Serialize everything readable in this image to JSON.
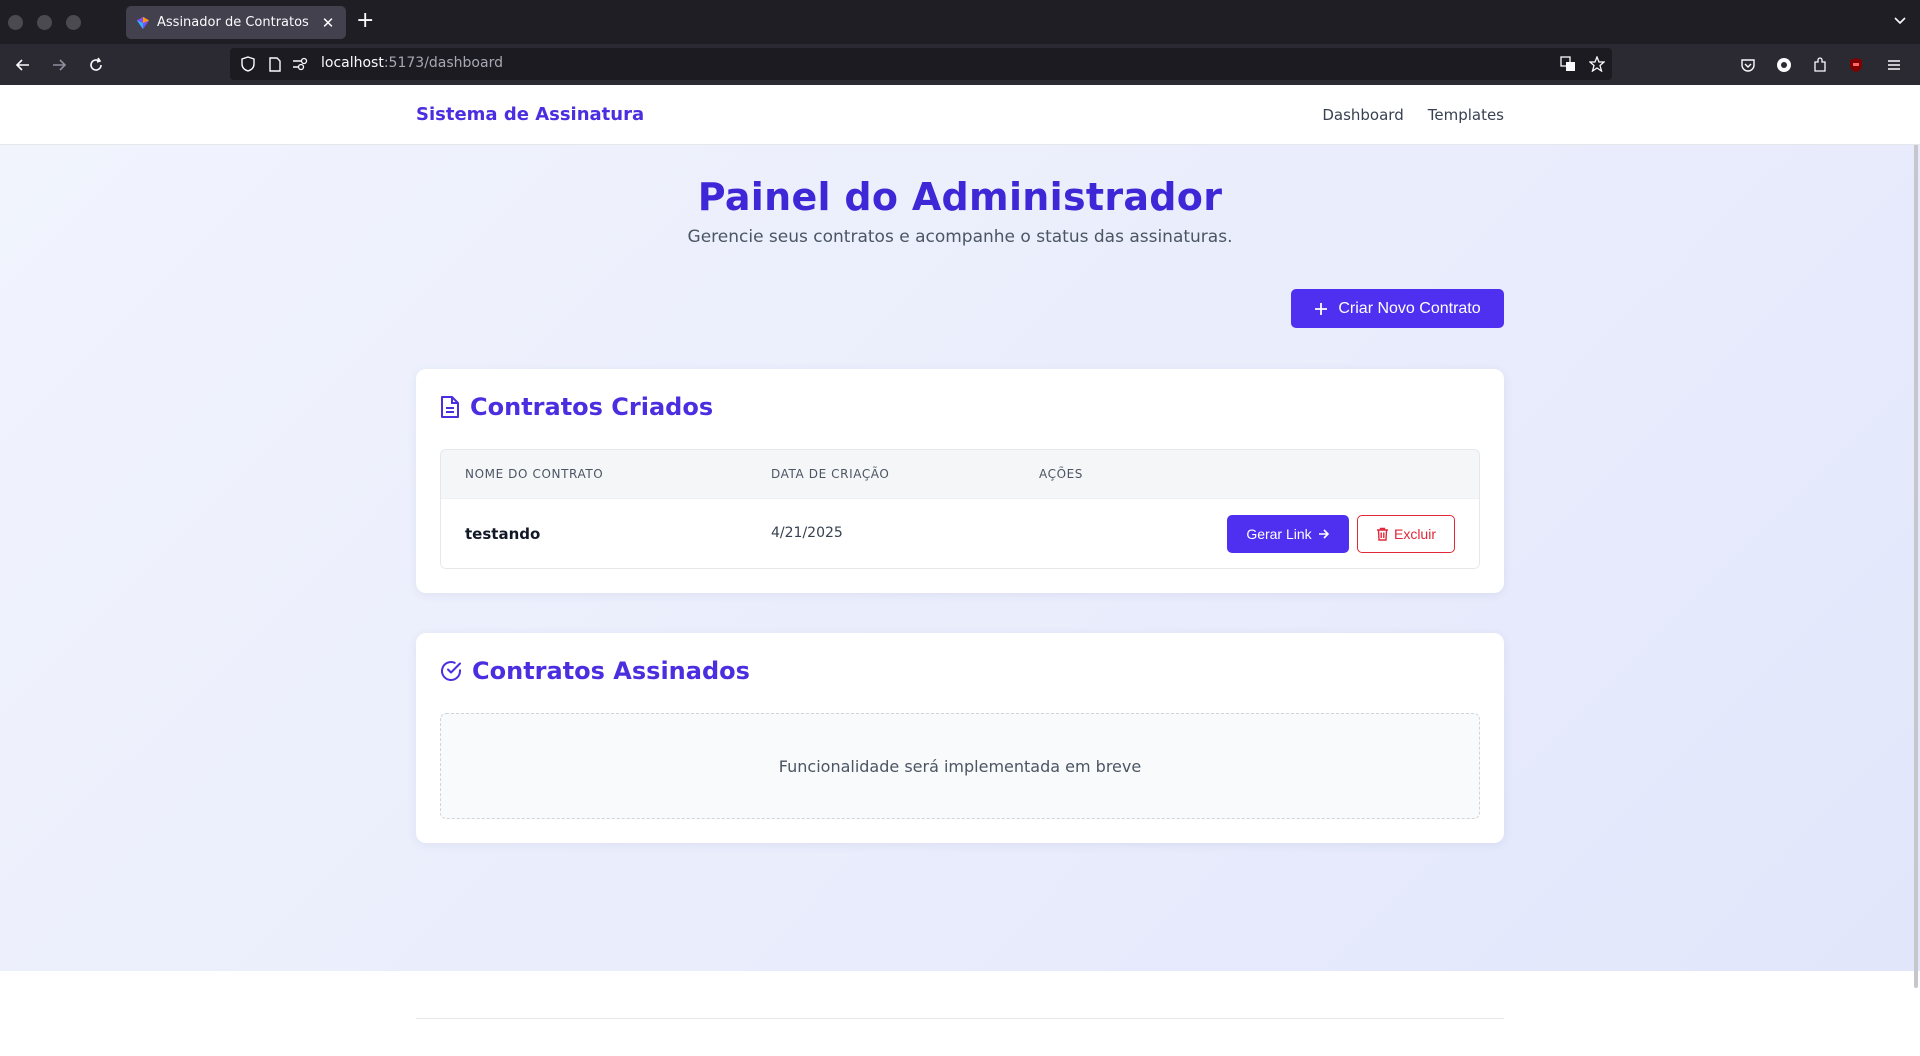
{
  "browser": {
    "tab_title": "Assinador de Contratos",
    "tab_close": "✕",
    "new_tab": "+",
    "url_host": "localhost",
    "url_path": ":5173/dashboard"
  },
  "header": {
    "brand": "Sistema de Assinatura",
    "nav": [
      "Dashboard",
      "Templates"
    ]
  },
  "main": {
    "title": "Painel do Administrador",
    "subtitle": "Gerencie seus contratos e acompanhe o status das assinaturas.",
    "create_button": "Criar Novo Contrato"
  },
  "created": {
    "title": "Contratos Criados",
    "columns": [
      "NOME DO CONTRATO",
      "DATA DE CRIAÇÃO",
      "AÇÕES"
    ],
    "rows": [
      {
        "name": "testando",
        "date": "4/21/2025",
        "link_label": "Gerar Link",
        "delete_label": "Excluir"
      }
    ]
  },
  "signed": {
    "title": "Contratos Assinados",
    "empty_text": "Funcionalidade será implementada em breve"
  },
  "colors": {
    "accent": "#4f2ff0",
    "title": "#3d27d6",
    "danger": "#e0283a"
  },
  "icons": {
    "create": "plus-icon",
    "created_card": "document-icon",
    "signed_card": "check-circle-icon",
    "link": "arrow-right-icon",
    "delete": "trash-icon"
  }
}
